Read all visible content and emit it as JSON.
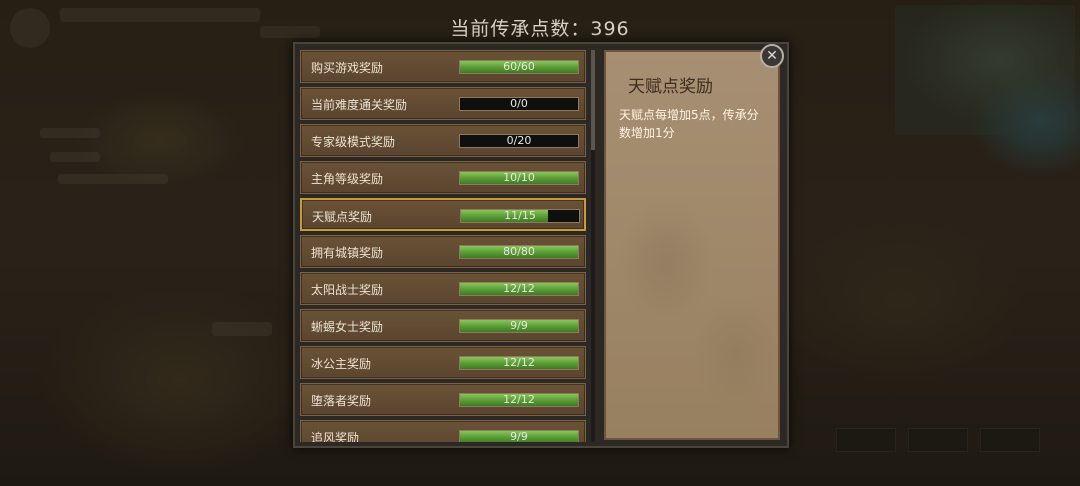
{
  "header": {
    "points_text": "当前传承点数：396"
  },
  "rewards": [
    {
      "label": "购买游戏奖励",
      "value": "60/60",
      "progress": 1.0
    },
    {
      "label": "当前难度通关奖励",
      "value": "0/0",
      "progress": 0
    },
    {
      "label": "专家级模式奖励",
      "value": "0/20",
      "progress": 0
    },
    {
      "label": "主角等级奖励",
      "value": "10/10",
      "progress": 1.0
    },
    {
      "label": "天赋点奖励",
      "value": "11/15",
      "progress": 0.7333
    },
    {
      "label": "拥有城镇奖励",
      "value": "80/80",
      "progress": 1.0
    },
    {
      "label": "太阳战士奖励",
      "value": "12/12",
      "progress": 1.0
    },
    {
      "label": "蜥蜴女士奖励",
      "value": "9/9",
      "progress": 1.0
    },
    {
      "label": "冰公主奖励",
      "value": "12/12",
      "progress": 1.0
    },
    {
      "label": "堕落者奖励",
      "value": "12/12",
      "progress": 1.0
    },
    {
      "label": "追风奖励",
      "value": "9/9",
      "progress": 1.0
    }
  ],
  "selected_index": 4,
  "detail": {
    "title": "天赋点奖励",
    "description": "天赋点每增加5点，传承分数增加1分"
  },
  "close_icon": "close-icon"
}
